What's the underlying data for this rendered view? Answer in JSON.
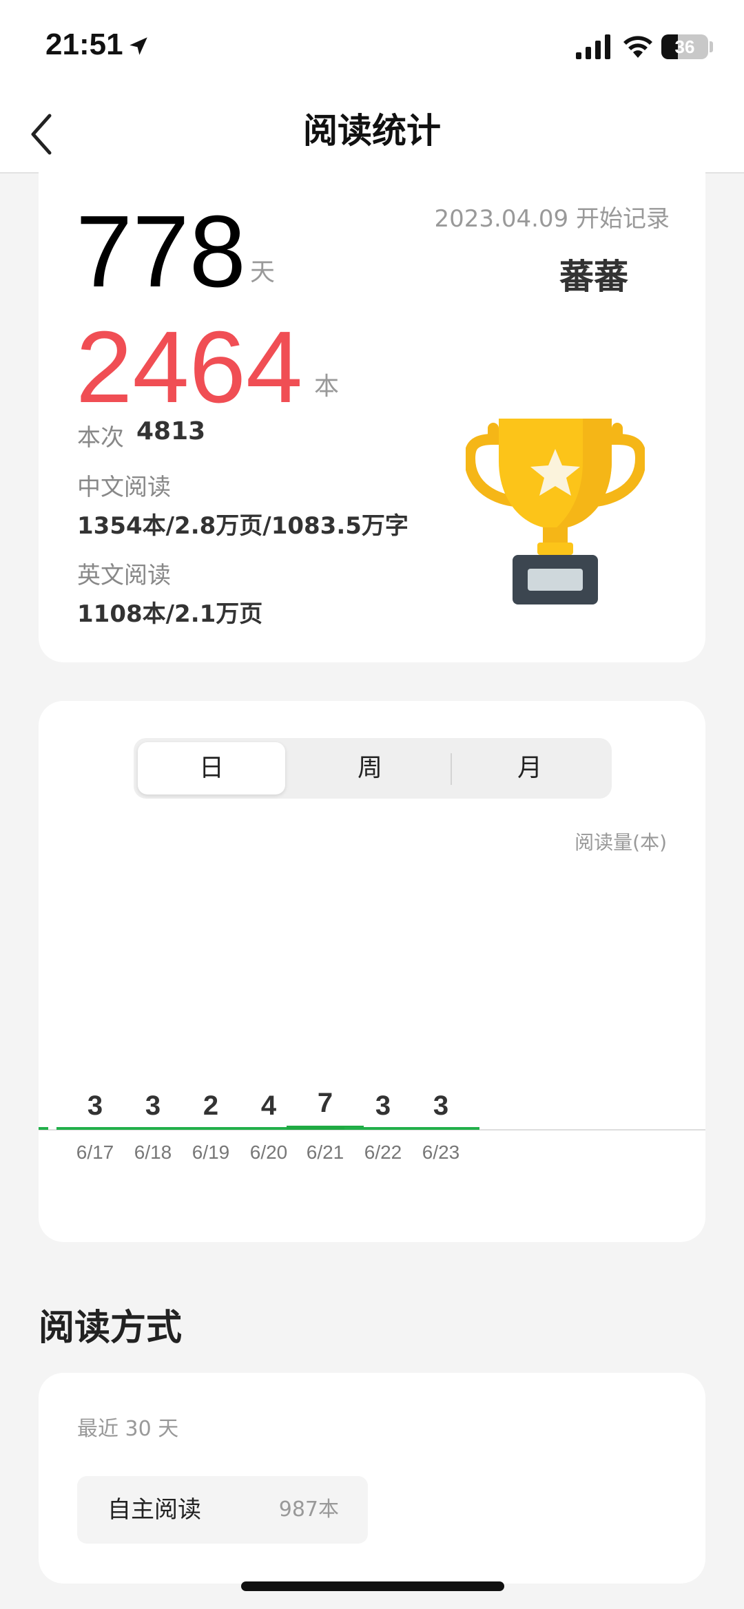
{
  "status_bar": {
    "time": "21:51",
    "battery_level": "36",
    "battery_fraction": 0.36
  },
  "nav": {
    "title": "阅读统计"
  },
  "summary": {
    "days_value": "778",
    "days_unit": "天",
    "books_value": "2464",
    "books_unit": "本",
    "session_label": "本次",
    "session_value": "4813",
    "chinese_label": "中文阅读",
    "chinese_value": "1354本/2.8万页/1083.5万字",
    "english_label": "英文阅读",
    "english_value": "1108本/2.1万页",
    "start_date": "2023.04.09 开始记录",
    "username": "蕃蕃"
  },
  "period_tabs": {
    "day": "日",
    "week": "周",
    "month": "月",
    "selected": "day"
  },
  "chart_data": {
    "type": "bar",
    "ylabel": "阅读量(本)",
    "categories": [
      "6/17",
      "6/18",
      "6/19",
      "6/20",
      "6/21",
      "6/22",
      "6/23"
    ],
    "values": [
      3,
      3,
      2,
      4,
      7,
      3,
      3
    ],
    "highlighted": "6/21",
    "colors": {
      "bar": "#22b04a",
      "bar_highlight": "#1faa43",
      "label": "#333333",
      "tick": "#777777",
      "axis": "#dddddd"
    }
  },
  "reading_mode": {
    "section_title": "阅读方式",
    "period_label": "最近 30 天",
    "items": [
      {
        "name": "自主阅读",
        "count": "987本"
      }
    ]
  }
}
